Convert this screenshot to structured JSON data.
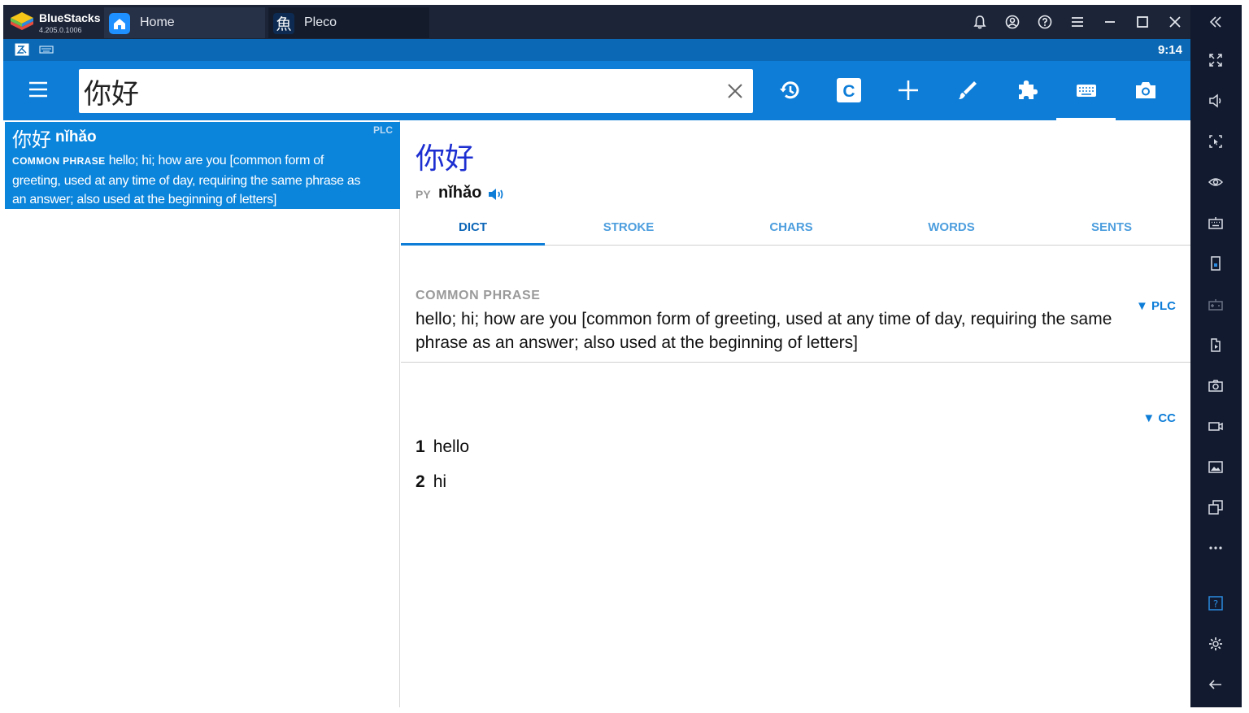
{
  "titlebar": {
    "brand_name": "BlueStacks",
    "brand_version": "4.205.0.1006",
    "tabs": [
      {
        "label": "Home",
        "icon": "home-icon"
      },
      {
        "label": "Pleco",
        "icon": "pleco-app-icon"
      }
    ]
  },
  "statusbar": {
    "clock": "9:14"
  },
  "appbar": {
    "search_value": "你好",
    "active_input": "keyboard-icon"
  },
  "result": {
    "hanzi": "你好",
    "pinyin": "nǐhǎo",
    "source": "PLC",
    "pos": "COMMON PHRASE",
    "definition": "hello; hi; how are you [common form of greeting, used at any time of day, requiring the same phrase as an answer; also used at the beginning of letters]"
  },
  "detail": {
    "hanzi": "你好",
    "py_label": "PY",
    "pinyin": "nǐhǎo",
    "tabs": [
      "DICT",
      "STROKE",
      "CHARS",
      "WORDS",
      "SENTS"
    ],
    "active_tab": "DICT",
    "plc": {
      "tag": "▼ PLC",
      "pos": "COMMON PHRASE",
      "definition": "hello; hi; how are you [common form of greeting, used at any time of day, requiring the same phrase as an answer; also used at the beginning of letters]"
    },
    "cc": {
      "tag": "▼  CC",
      "defs": [
        {
          "num": "1",
          "text": "hello"
        },
        {
          "num": "2",
          "text": "hi"
        }
      ]
    }
  },
  "colors": {
    "appbar": "#0d7dd8",
    "statusbar": "#0a68b4",
    "selected_row": "#0b85dc",
    "headword": "#1d2fd1",
    "frame": "#111a2e"
  }
}
